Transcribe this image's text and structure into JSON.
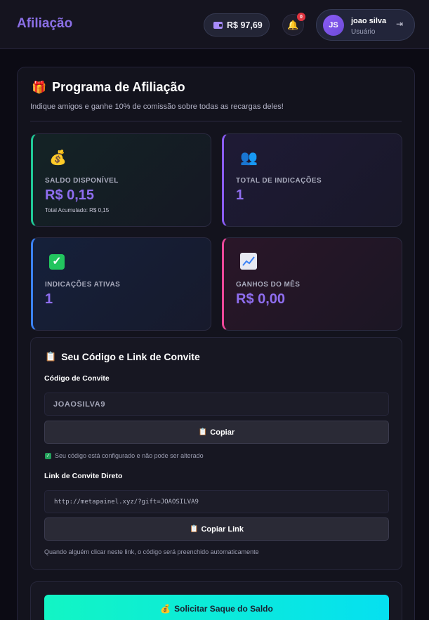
{
  "header": {
    "brand": "Afiliação",
    "balance": "R$ 97,69",
    "notification_count": "0",
    "user": {
      "initials": "JS",
      "name": "joao silva",
      "role": "Usuário"
    }
  },
  "page": {
    "title": "Programa de Afiliação",
    "subtitle": "Indique amigos e ganhe 10% de comissão sobre todas as recargas deles!"
  },
  "stats": [
    {
      "label": "SALDO DISPONÍVEL",
      "value": "R$ 0,15",
      "sub": "Total Acumulado: R$ 0,15",
      "icon": "money-bag-icon"
    },
    {
      "label": "TOTAL DE INDICAÇÕES",
      "value": "1",
      "icon": "people-icon"
    },
    {
      "label": "INDICAÇÕES ATIVAS",
      "value": "1",
      "icon": "check-icon"
    },
    {
      "label": "GANHOS DO MÊS",
      "value": "R$ 0,00",
      "icon": "chart-up-icon"
    }
  ],
  "invite": {
    "title": "Seu Código e Link de Convite",
    "code_label": "Código de Convite",
    "code_value": "JOAOSILVA9",
    "copy_label": "Copiar",
    "locked_note": "Seu código está configurado e não pode ser alterado",
    "link_label": "Link de Convite Direto",
    "link_value": "http://metapainel.xyz/?gift=JOAOSILVA9",
    "copy_link_label": "Copiar Link",
    "hint": "Quando alguém clicar neste link, o código será preenchido automaticamente"
  },
  "withdraw": {
    "label": "Solicitar Saque do Saldo"
  },
  "colors": {
    "accent": "#8b6fe6",
    "green": "#20c997",
    "purple": "#8b5cf6",
    "blue": "#3b82f6",
    "pink": "#ec4899",
    "cta_start": "#12f5c4",
    "cta_end": "#05e0f0"
  }
}
